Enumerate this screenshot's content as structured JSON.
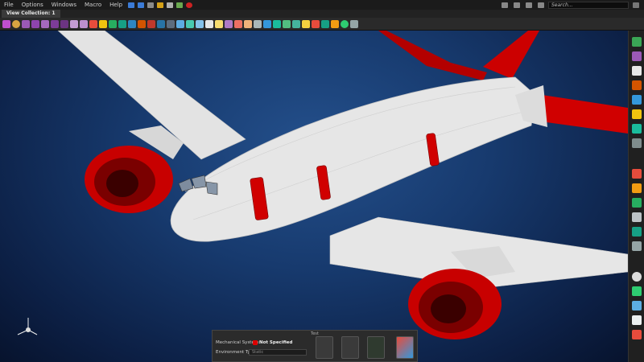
{
  "menu": {
    "items": [
      "File",
      "Options",
      "Windows",
      "Macro",
      "Help"
    ],
    "search_placeholder": "Search..."
  },
  "tabs": [
    {
      "label": "View Collection: 1",
      "active": true
    }
  ],
  "panel": {
    "title": "Test",
    "mechanical_system_label": "Mechanical System:",
    "mechanical_system_value": "Not Specified",
    "environment_type_label": "Environment Type:",
    "environment_type_value": "Static"
  },
  "colors": {
    "accent_red": "#e00000",
    "background_blue": "#173a6e",
    "fuselage": "#e6e6e6"
  }
}
